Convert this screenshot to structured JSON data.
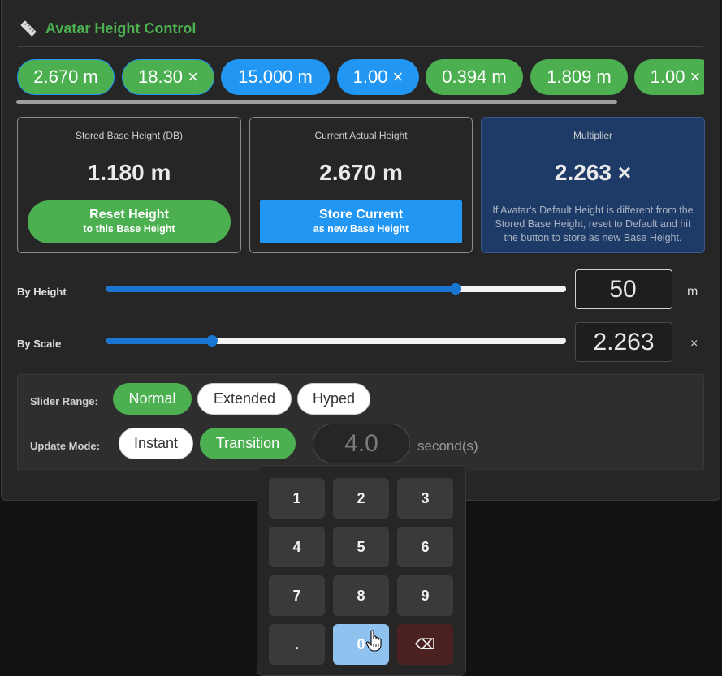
{
  "title": "Avatar Height Control",
  "presets": [
    {
      "label": "2.670 m",
      "color": "green",
      "selected": true
    },
    {
      "label": "18.30 ×",
      "color": "green",
      "selected": true
    },
    {
      "label": "15.000 m",
      "color": "blue",
      "selected": false
    },
    {
      "label": "1.00 ×",
      "color": "blue",
      "selected": false
    },
    {
      "label": "0.394 m",
      "color": "green",
      "selected": false
    },
    {
      "label": "1.809 m",
      "color": "green",
      "selected": false
    },
    {
      "label": "1.00 ×",
      "color": "green",
      "selected": false
    }
  ],
  "cards": {
    "stored": {
      "label": "Stored Base Height (DB)",
      "value": "1.180 m",
      "button_main": "Reset Height",
      "button_sub": "to this Base Height"
    },
    "current": {
      "label": "Current Actual Height",
      "value": "2.670 m",
      "button_main": "Store Current",
      "button_sub": "as new Base Height"
    },
    "multiplier": {
      "label": "Multiplier",
      "value": "2.263 ×",
      "note": "If Avatar's Default Height is different from the Stored Base Height, reset to Default and hit the button to store as new Base Height."
    }
  },
  "by_height": {
    "label": "By Height",
    "input_value": "50",
    "unit": "m",
    "slider_level": 0.76
  },
  "by_scale": {
    "label": "By Scale",
    "input_value": "2.263",
    "unit": "×",
    "slider_level": 0.23
  },
  "slider_range": {
    "label": "Slider Range:",
    "options": [
      "Normal",
      "Extended",
      "Hyped"
    ],
    "selected": "Normal"
  },
  "update_mode": {
    "label": "Update Mode:",
    "options": [
      "Instant",
      "Transition"
    ],
    "selected": "Transition",
    "duration": "4.0",
    "duration_unit": "second(s)"
  },
  "keypad": {
    "keys": [
      "1",
      "2",
      "3",
      "4",
      "5",
      "6",
      "7",
      "8",
      "9",
      ".",
      "0",
      "⌫"
    ],
    "active_key": "0"
  },
  "colors": {
    "accent_green": "#4caf50",
    "accent_blue": "#2196f3",
    "slider_blue": "#1976d2",
    "multiplier_card": "#1e3a66"
  }
}
